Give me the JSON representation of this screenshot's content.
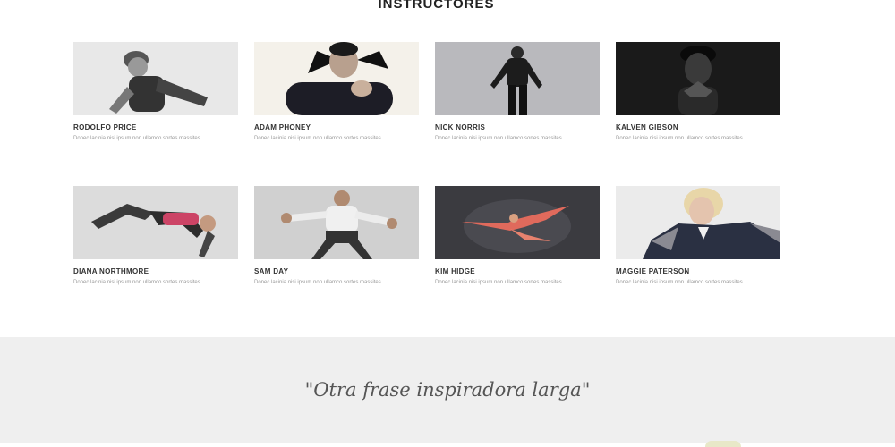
{
  "section": {
    "title": "INSTRUCTORES"
  },
  "instructors": [
    {
      "name": "RODOLFO PRICE",
      "description": "Donec lacinia nisi ipsum non ullamco sortes massites."
    },
    {
      "name": "ADAM PHONEY",
      "description": "Donec lacinia nisi ipsum non ullamco sortes massites."
    },
    {
      "name": "NICK NORRIS",
      "description": "Donec lacinia nisi ipsum non ullamco sortes massites."
    },
    {
      "name": "KALVEN GIBSON",
      "description": "Donec lacinia nisi ipsum non ullamco sortes massites."
    },
    {
      "name": "DIANA NORTHMORE",
      "description": "Donec lacinia nisi ipsum non ullamco sortes massites."
    },
    {
      "name": "SAM DAY",
      "description": "Donec lacinia nisi ipsum non ullamco sortes massites."
    },
    {
      "name": "KIM HIDGE",
      "description": "Donec lacinia nisi ipsum non ullamco sortes massites."
    },
    {
      "name": "MAGGIE PATERSON",
      "description": "Donec lacinia nisi ipsum non ullamco sortes massites."
    }
  ],
  "quote": {
    "text": "\"Otra frase inspiradora larga\""
  }
}
